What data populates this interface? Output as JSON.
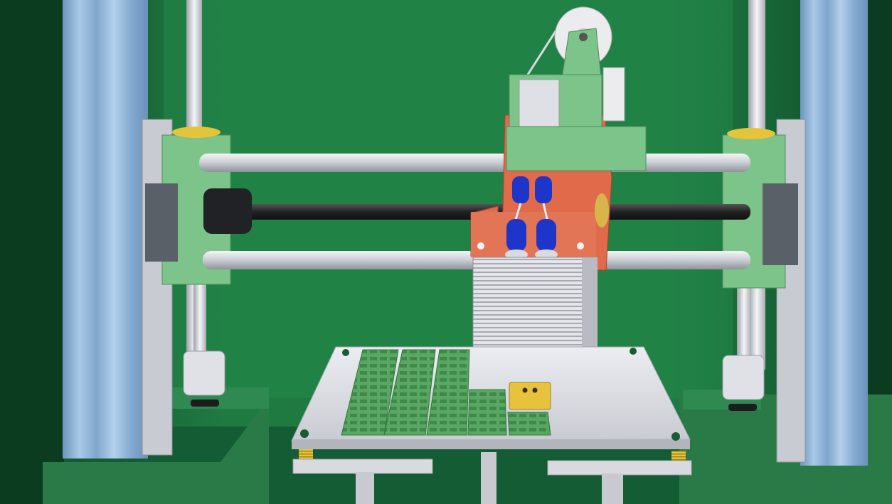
{
  "scene": {
    "subject": "3d-printer-render",
    "colors": {
      "background": "#1f7a42",
      "background_dark": "#0f4a2a",
      "rail_blue": "#8fb4d8",
      "frame_aluminum": "#c8ccd2",
      "printed_parts": "#7cc48a",
      "carriage_orange": "#e06a4a",
      "heatsink": "#dcdde2",
      "nozzle_blue": "#1d36c9",
      "bed": "#dfe0e6",
      "pcb_green": "#4a9a54",
      "spring_yellow": "#e5c43a",
      "base_block": "#2a7a48"
    }
  }
}
